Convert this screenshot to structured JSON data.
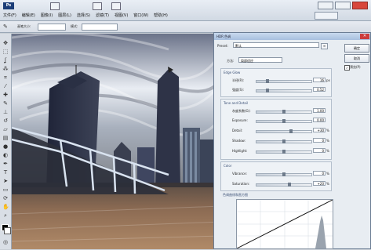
{
  "menu": [
    "文件(F)",
    "编辑(E)",
    "图像(I)",
    "图层(L)",
    "选择(S)",
    "滤镜(T)",
    "视图(V)",
    "窗口(W)",
    "帮助(H)"
  ],
  "options_bar": {
    "size_label": "画笔大小:",
    "mode_label": "模式:"
  },
  "dialog": {
    "title": "HDR 色调",
    "preset_label": "Preset:",
    "preset_value": "默认",
    "method_label": "方法:",
    "method_value": "局部适应",
    "buttons": {
      "ok": "确定",
      "cancel": "取消"
    },
    "preview_label": "预览(P)",
    "edge_glow": {
      "title": "Edge Glow",
      "radius": {
        "label": "半径(R):",
        "value": "16",
        "unit": "px",
        "fraction": 0.2
      },
      "strength": {
        "label": "强度(S):",
        "value": "0.52",
        "unit": "",
        "fraction": 0.2
      }
    },
    "tone_detail": {
      "title": "Tone and Detail",
      "gamma": {
        "label": "灰度系数(G):",
        "value": "1.00",
        "unit": "",
        "fraction": 0.5
      },
      "exposure": {
        "label": "Exposure:",
        "value": "0.00",
        "unit": "",
        "fraction": 0.5
      },
      "detail": {
        "label": "Detail:",
        "value": "+30",
        "unit": "%",
        "fraction": 0.63
      },
      "shadow": {
        "label": "Shadow:",
        "value": "0",
        "unit": "%",
        "fraction": 0.5
      },
      "highlight": {
        "label": "Highlight:",
        "value": "0",
        "unit": "%",
        "fraction": 0.5
      }
    },
    "color": {
      "title": "Color",
      "vibrance": {
        "label": "Vibrance:",
        "value": "0",
        "unit": "%",
        "fraction": 0.5
      },
      "saturation": {
        "label": "Saturation:",
        "value": "+20",
        "unit": "%",
        "fraction": 0.6
      }
    },
    "curve": {
      "title": "色调曲线和直方图"
    }
  }
}
